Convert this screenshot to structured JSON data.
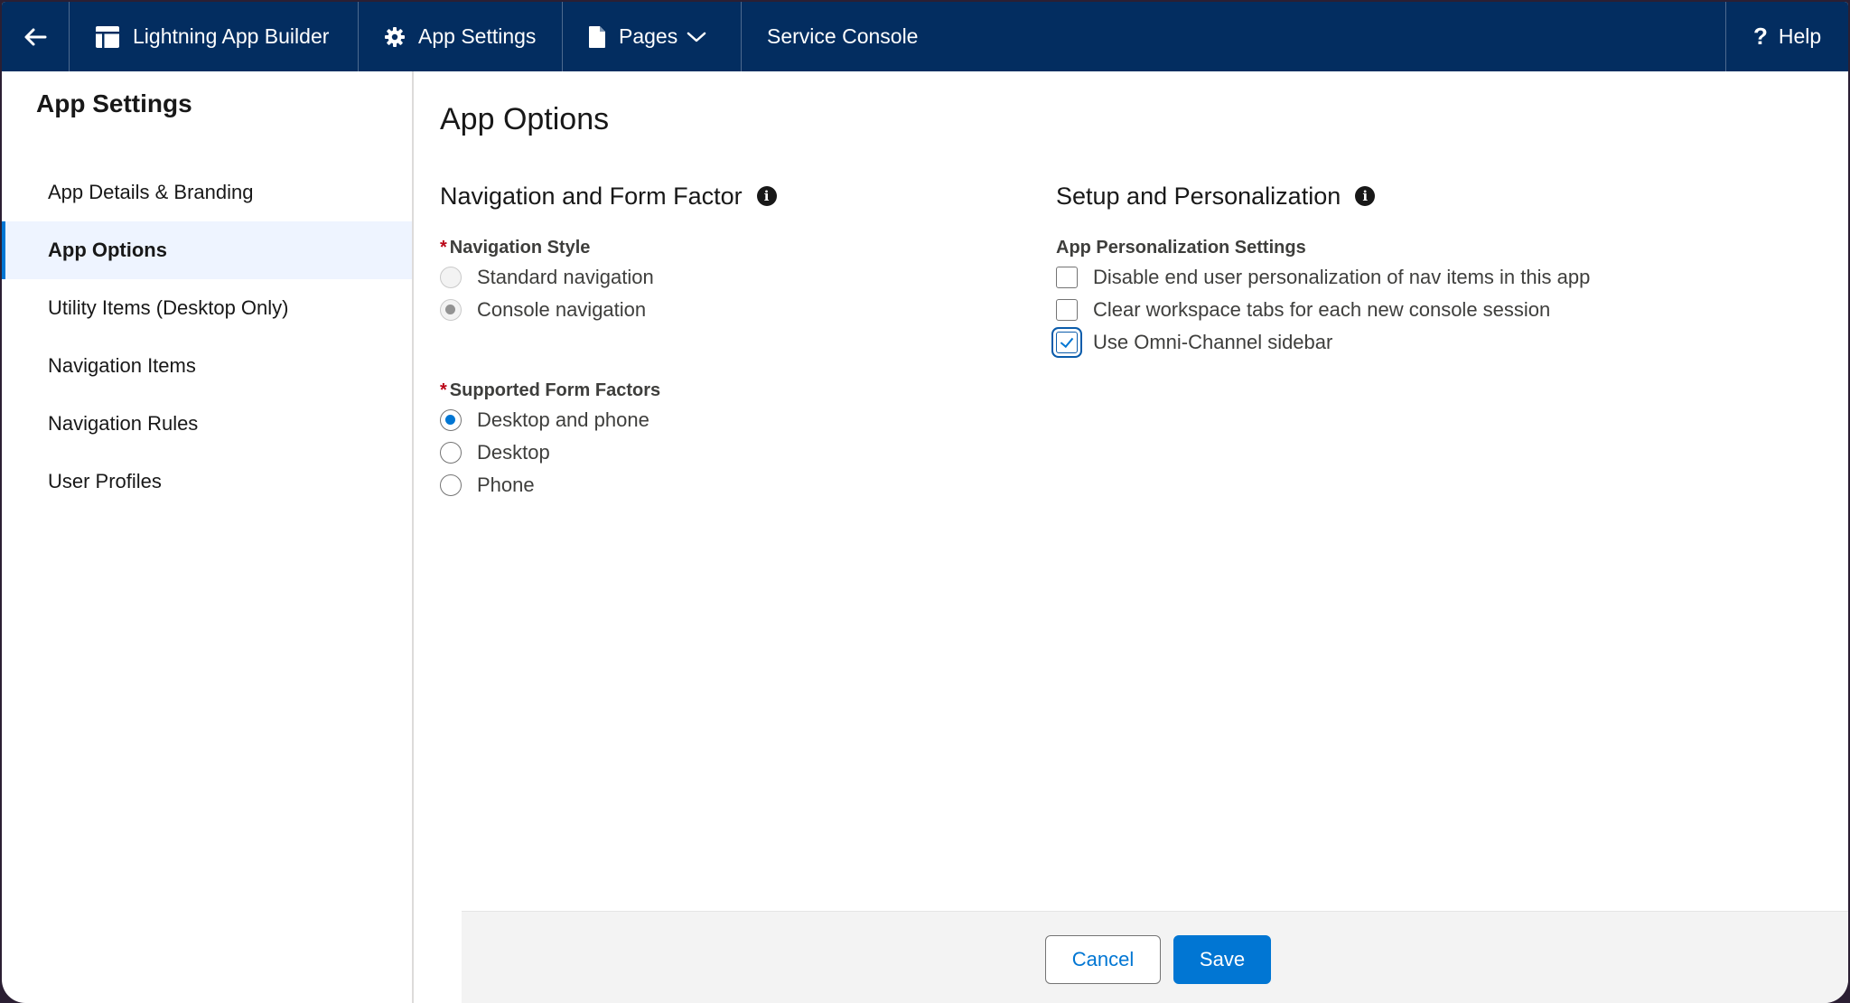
{
  "topbar": {
    "back_icon": "back-arrow-icon",
    "builder_label": "Lightning App Builder",
    "settings_label": "App Settings",
    "pages_label": "Pages",
    "app_name": "Service Console",
    "help_label": "Help"
  },
  "sidebar": {
    "title": "App Settings",
    "items": [
      {
        "label": "App Details & Branding"
      },
      {
        "label": "App Options"
      },
      {
        "label": "Utility Items (Desktop Only)"
      },
      {
        "label": "Navigation Items"
      },
      {
        "label": "Navigation Rules"
      },
      {
        "label": "User Profiles"
      }
    ]
  },
  "main": {
    "title": "App Options",
    "nav_section": {
      "title": "Navigation and Form Factor",
      "nav_style_label": "Navigation Style",
      "nav_style_options": [
        {
          "label": "Standard navigation",
          "checked": false
        },
        {
          "label": "Console navigation",
          "checked": true
        }
      ],
      "form_factor_label": "Supported Form Factors",
      "form_factor_options": [
        {
          "label": "Desktop and phone",
          "checked": true
        },
        {
          "label": "Desktop",
          "checked": false
        },
        {
          "label": "Phone",
          "checked": false
        }
      ]
    },
    "setup_section": {
      "title": "Setup and Personalization",
      "group_label": "App Personalization Settings",
      "options": [
        {
          "label": "Disable end user personalization of nav items in this app",
          "checked": false
        },
        {
          "label": "Clear workspace tabs for each new console session",
          "checked": false
        },
        {
          "label": "Use Omni-Channel sidebar",
          "checked": true
        }
      ]
    }
  },
  "footer": {
    "cancel_label": "Cancel",
    "save_label": "Save"
  },
  "colors": {
    "topbar_bg": "#032d60",
    "brand_blue": "#0176d3",
    "required": "#ba0517"
  }
}
